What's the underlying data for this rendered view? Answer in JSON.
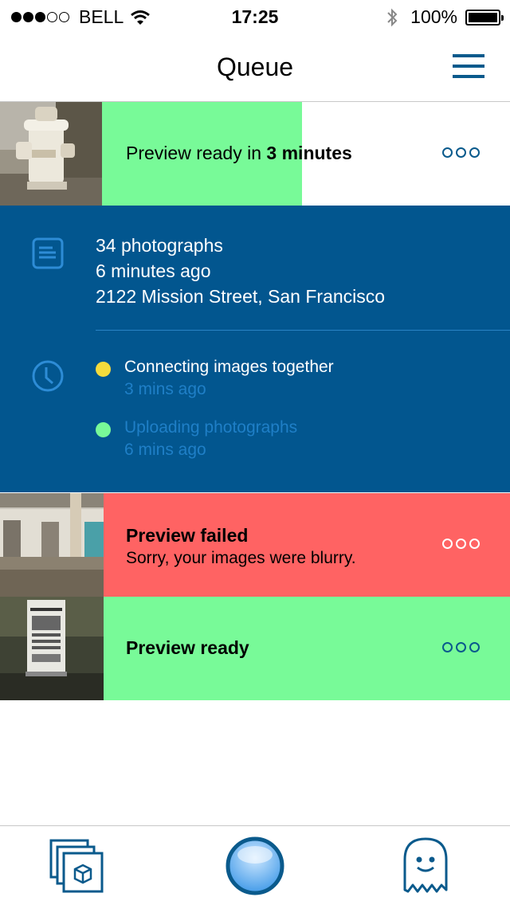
{
  "status_bar": {
    "carrier": "BELL",
    "time": "17:25",
    "battery": "100%",
    "signal_icon": "signal-dots-icon",
    "wifi_icon": "wifi-icon",
    "bluetooth_icon": "bluetooth-icon"
  },
  "nav": {
    "title": "Queue",
    "menu_icon": "hamburger-menu-icon"
  },
  "queue": {
    "item1": {
      "status_prefix": "Preview ready in ",
      "status_bold": "3 minutes",
      "progress": 0.49,
      "color": "#78fa98"
    },
    "details": {
      "photo_count": "34 photographs",
      "captured_ago": "6 minutes ago",
      "location": "2122 Mission Street, San Francisco",
      "events": [
        {
          "title": "Connecting images together",
          "time": "3 mins ago",
          "dot_color": "#f5db3c"
        },
        {
          "title": "Uploading photographs",
          "time": "6 mins ago",
          "dot_color": "#78fa98"
        }
      ]
    },
    "item2": {
      "title": "Preview failed",
      "subtitle": "Sorry, your images were blurry.",
      "color": "#ff6363"
    },
    "item3": {
      "title": "Preview ready",
      "color": "#78fa98"
    }
  },
  "colors": {
    "accent": "#0a5a8c",
    "detail_bg": "#02568f"
  },
  "tabbar": {
    "tabs": [
      {
        "icon": "gallery-stack-icon"
      },
      {
        "icon": "camera-shutter-icon"
      },
      {
        "icon": "ghost-profile-icon"
      }
    ]
  }
}
